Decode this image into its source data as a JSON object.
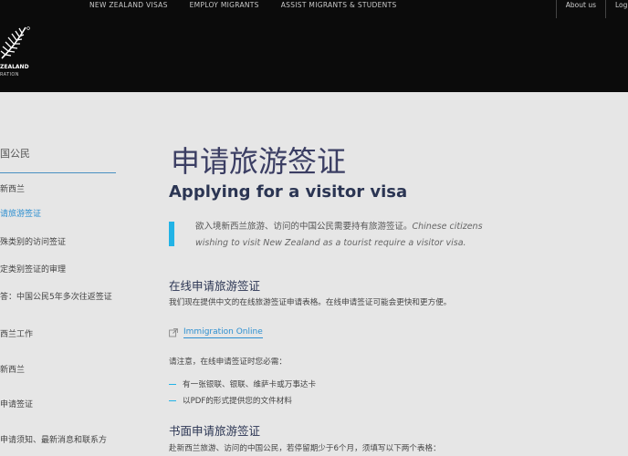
{
  "header": {
    "nav": [
      "NEW ZEALAND VISAS",
      "EMPLOY MIGRANTS",
      "ASSIST MIGRANTS & STUDENTS"
    ],
    "utility": [
      "About us",
      "Login"
    ],
    "logo_line1": "ZEALAND",
    "logo_line2": "RATION"
  },
  "sidebar": {
    "heading": "国公民",
    "items": [
      {
        "label": "新西兰"
      },
      {
        "label": "请旅游签证"
      },
      {
        "label": "殊类别的访问签证"
      },
      {
        "label": "定类别签证的审理"
      },
      {
        "label": "答：中国公民5年多次往返签证"
      },
      {
        "label": "西兰工作"
      },
      {
        "label": "新西兰"
      },
      {
        "label": "申请签证"
      },
      {
        "label": "申请须知、最新消息和联系方"
      }
    ]
  },
  "main": {
    "title_zh": "申请旅游签证",
    "title_en": "Applying for a visitor visa",
    "intro_zh": "欲入境新西兰旅游、访问的中国公民需要持有旅游签证。",
    "intro_en": "Chinese citizens wishing to visit New Zealand as a tourist require a visitor visa.",
    "online_heading": "在线申请旅游签证",
    "online_text": "我们现在提供中文的在线旅游签证申请表格。在线申请签证可能会更快和更方便。",
    "online_link": "Immigration Online",
    "note": "请注意，在线申请签证时您必需：",
    "bullets": [
      "有一张银联、银联、维萨卡或万事达卡",
      "以PDF的形式提供您的文件材料"
    ],
    "paper_heading": "书面申请旅游签证",
    "paper_text": "赴新西兰旅游、访问的中国公民，若停留期少于6个月，须填写以下两个表格："
  }
}
